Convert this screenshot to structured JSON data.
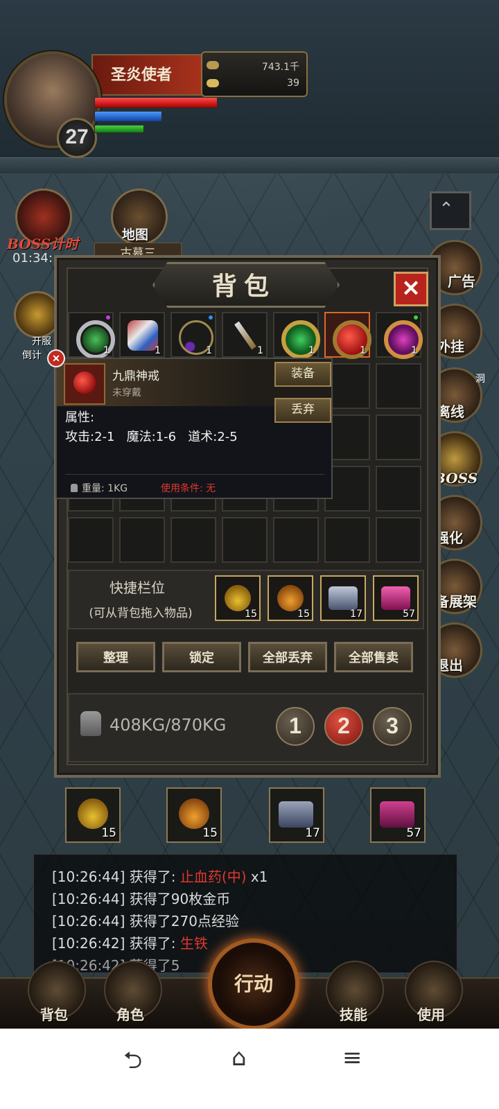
{
  "player": {
    "name": "圣炎使者",
    "level": "27",
    "gold": "743.1千",
    "ingot": "39"
  },
  "left_buttons": {
    "boss_timer_label": "BOSS计时",
    "boss_timer_time": "01:34:",
    "map_label": "地图",
    "map_sub": "古墓三",
    "kaifu_label": "开服",
    "countdown_label": "倒计"
  },
  "side_menu": [
    "广告",
    "外挂",
    "离线",
    "BOSS",
    "强化",
    "备展架",
    "退出"
  ],
  "side_edge": {
    "top": "洞"
  },
  "bag": {
    "title": "背包",
    "close": "✕",
    "row1_counts": [
      "1",
      "1",
      "1",
      "1",
      "1",
      "1",
      "1"
    ],
    "tooltip": {
      "name": "九鼎神戒",
      "status": "未穿戴",
      "equip_btn": "装备",
      "discard_btn": "丢弃",
      "attr_label": "属性:",
      "stats": "攻击:2-1   魔法:1-6   道术:2-5",
      "weight": "重量: 1KG",
      "condition": "使用条件: 无"
    },
    "quick": {
      "label": "快捷栏位",
      "hint": "(可从背包拖入物品)",
      "counts": [
        "15",
        "15",
        "17",
        "57"
      ]
    },
    "actions": {
      "sort": "整理",
      "lock": "锁定",
      "discard_all": "全部丢弃",
      "sell_all": "全部售卖"
    },
    "weight": "408KG/870KG",
    "pages": [
      "1",
      "2",
      "3"
    ],
    "active_page": "2"
  },
  "hot_slots": {
    "counts": [
      "15",
      "15",
      "17",
      "57"
    ]
  },
  "log": {
    "lines": [
      {
        "time": "[10:26:44]",
        "text": "获得了: ",
        "item": "止血药(中)",
        "suffix": " x1"
      },
      {
        "time": "[10:26:44]",
        "text": "获得了90枚金币"
      },
      {
        "time": "[10:26:44]",
        "text": "获得了270点经验"
      },
      {
        "time": "[10:26:42]",
        "text": "获得了: ",
        "item": "生铁"
      },
      {
        "time": "[10:26:42]",
        "text": "获得了5"
      }
    ]
  },
  "bottom_menu": {
    "bag": "背包",
    "role": "角色",
    "action": "行动",
    "skill": "技能",
    "use": "使用"
  },
  "navbar": {
    "back": "⮌",
    "home": "⌂",
    "menu": "≡"
  },
  "colors": {
    "red_text": "#e0382e",
    "gold_border": "#c8a860"
  }
}
